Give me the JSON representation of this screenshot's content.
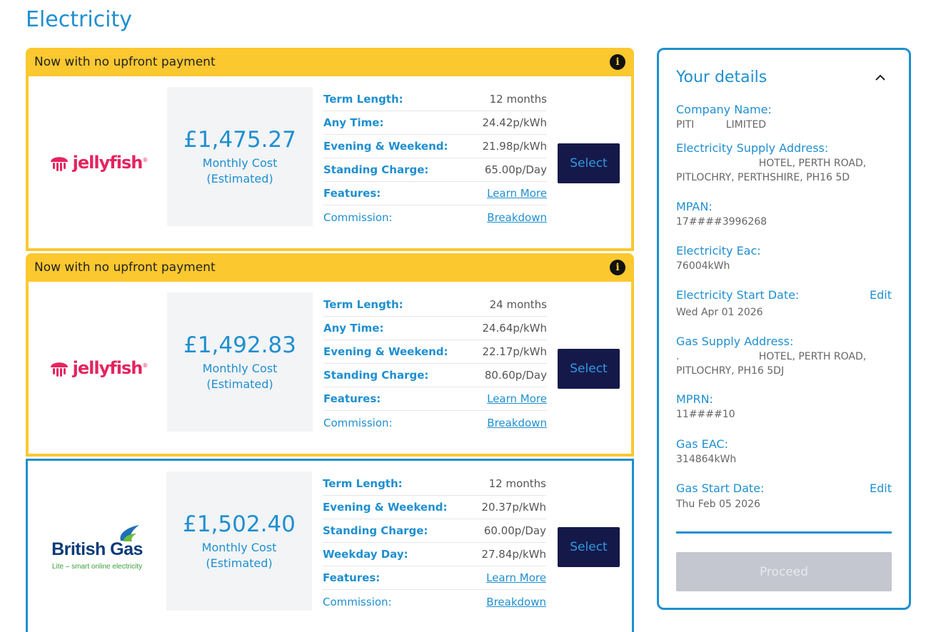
{
  "page": {
    "title": "Electricity"
  },
  "offers": [
    {
      "promo": "Now with no upfront payment",
      "supplier": "jellyfish",
      "cost": "£1,475.27",
      "cost_label_1": "Monthly Cost",
      "cost_label_2": "(Estimated)",
      "rows": [
        {
          "key": "Term Length:",
          "value": "12 months"
        },
        {
          "key": "Any Time:",
          "value": "24.42p/kWh"
        },
        {
          "key": "Evening & Weekend:",
          "value": "21.98p/kWh"
        },
        {
          "key": "Standing Charge:",
          "value": "65.00p/Day"
        },
        {
          "key": "Features:",
          "value": "Learn More"
        },
        {
          "key": "Commission:",
          "value": "Breakdown"
        }
      ],
      "select": "Select"
    },
    {
      "promo": "Now with no upfront payment",
      "supplier": "jellyfish",
      "cost": "£1,492.83",
      "cost_label_1": "Monthly Cost",
      "cost_label_2": "(Estimated)",
      "rows": [
        {
          "key": "Term Length:",
          "value": "24 months"
        },
        {
          "key": "Any Time:",
          "value": "24.64p/kWh"
        },
        {
          "key": "Evening & Weekend:",
          "value": "22.17p/kWh"
        },
        {
          "key": "Standing Charge:",
          "value": "80.60p/Day"
        },
        {
          "key": "Features:",
          "value": "Learn More"
        },
        {
          "key": "Commission:",
          "value": "Breakdown"
        }
      ],
      "select": "Select"
    },
    {
      "supplier": "British Gas",
      "supplier_tagline": "Lite – smart online electricity",
      "cost": "£1,502.40",
      "cost_label_1": "Monthly Cost",
      "cost_label_2": "(Estimated)",
      "rows": [
        {
          "key": "Term Length:",
          "value": "12 months"
        },
        {
          "key": "Evening & Weekend:",
          "value": "20.37p/kWh"
        },
        {
          "key": "Standing Charge:",
          "value": "60.00p/Day"
        },
        {
          "key": "Weekday Day:",
          "value": "27.84p/kWh"
        },
        {
          "key": "Features:",
          "value": "Learn More"
        },
        {
          "key": "Commission:",
          "value": "Breakdown"
        }
      ],
      "select": "Select"
    }
  ],
  "details": {
    "title": "Your details",
    "edit": "Edit",
    "fields": [
      {
        "label": "Company Name:",
        "value_1": "PITI          LIMITED",
        "value_2": ""
      },
      {
        "label": "Electricity Supply Address:",
        "value_1": "                          HOTEL, PERTH ROAD,",
        "value_2": "PITLOCHRY, PERTHSHIRE, PH16 5D"
      },
      {
        "label": "MPAN:",
        "value_1": "17####3996268",
        "value_2": ""
      },
      {
        "label": "Electricity Eac:",
        "value_1": "76004kWh",
        "value_2": ""
      },
      {
        "label": "Electricity Start Date:",
        "value_1": "Wed Apr 01 2026",
        "value_2": ""
      },
      {
        "label": "Gas Supply Address:",
        "value_1": ".                         HOTEL, PERTH ROAD,",
        "value_2": "PITLOCHRY, PH16 5DJ"
      },
      {
        "label": "MPRN:",
        "value_1": "11####10",
        "value_2": ""
      },
      {
        "label": "Gas EAC:",
        "value_1": "314864kWh",
        "value_2": ""
      },
      {
        "label": "Gas Start Date:",
        "value_1": "Thu Feb 05 2026",
        "value_2": ""
      }
    ],
    "proceed": "Proceed"
  },
  "colors": {
    "accent": "#1f8fd0",
    "promo": "#fcc830",
    "button": "#15194a",
    "jellyfish": "#e5245f"
  }
}
